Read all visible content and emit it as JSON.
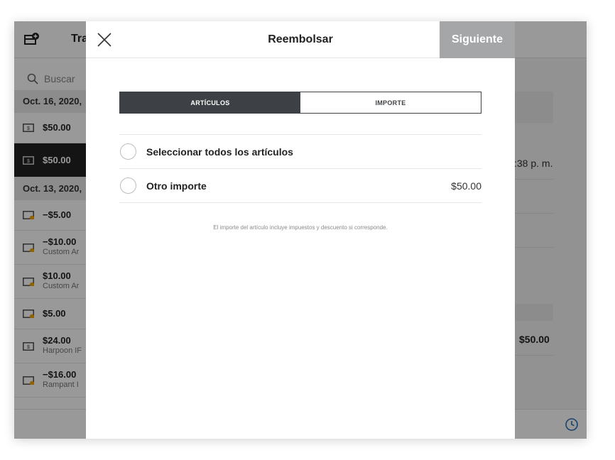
{
  "background": {
    "header_title": "Tra",
    "search_placeholder": "Buscar",
    "date_groups": [
      "Oct. 16, 2020,",
      "Oct. 13, 2020,"
    ],
    "rows": [
      {
        "amount": "$50.00",
        "sub": ""
      },
      {
        "amount": "$50.00",
        "sub": ""
      },
      {
        "amount": "−$5.00",
        "sub": ""
      },
      {
        "amount": "−$10.00",
        "sub": "Custom Ar"
      },
      {
        "amount": "$10.00",
        "sub": "Custom Ar"
      },
      {
        "amount": "$5.00",
        "sub": ""
      },
      {
        "amount": "$24.00",
        "sub": "Harpoon IF"
      },
      {
        "amount": "−$16.00",
        "sub": "Rampant I"
      }
    ],
    "time_fragment": ":38 p. m.",
    "total": "$50.00"
  },
  "modal": {
    "title": "Reembolsar",
    "next_label": "Siguiente",
    "tabs": [
      {
        "label": "ARTÍCULOS",
        "active": true
      },
      {
        "label": "IMPORTE",
        "active": false
      }
    ],
    "options": [
      {
        "label": "Seleccionar todos los artículos",
        "amount": ""
      },
      {
        "label": "Otro importe",
        "amount": "$50.00"
      }
    ],
    "note": "El importe del artículo incluye impuestos y descuento si corresponde."
  },
  "icons": {
    "close": "close-icon",
    "clock": "clock-icon",
    "cash": "cash-icon",
    "search": "search-icon",
    "new_sale": "new-sale-icon"
  },
  "colors": {
    "segment_active": "#3d4145",
    "next_button": "#a4a6a8",
    "overlay": "rgba(0,0,0,0.40)",
    "clock_accent": "#2b6fb5",
    "cash_accent": "#f0a500"
  }
}
